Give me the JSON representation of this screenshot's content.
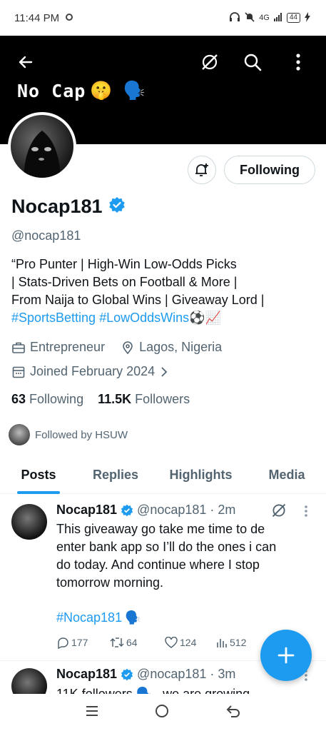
{
  "statusbar": {
    "time": "11:44 PM",
    "network": "4G",
    "battery": "44"
  },
  "header": {
    "title": "No Cap",
    "emoji1": "🤫",
    "emoji2": "🗣️"
  },
  "profile": {
    "follow_label": "Following",
    "name": "Nocap181",
    "handle": "@nocap181",
    "bio_lines": [
      "“Pro Punter | High-Win Low-Odds Picks",
      "| Stats-Driven Bets on Football & More |",
      "From Naija to Global Wins | Giveaway Lord |"
    ],
    "bio_tags": "#SportsBetting #LowOddsWins",
    "bio_emoji": "⚽📈",
    "category": "Entrepreneur",
    "location": "Lagos, Nigeria",
    "joined": "Joined February 2024",
    "following_count": "63",
    "following_label": "Following",
    "followers_count": "11.5K",
    "followers_label": "Followers",
    "followed_by": "Followed by HSUW"
  },
  "tabs": [
    "Posts",
    "Replies",
    "Highlights",
    "Media"
  ],
  "tweets": [
    {
      "name": "Nocap181",
      "handle": "@nocap181",
      "time": "· 2m",
      "lines": [
        "This giveaway go take me time to de",
        "enter bank app so I’ll do the ones i can",
        "do today. And continue where I stop",
        "tomorrow morning."
      ],
      "tag": "#Nocap181",
      "replies": "177",
      "retweets": "64",
      "likes": "124",
      "views": "512"
    },
    {
      "name": "Nocap181",
      "handle": "@nocap181",
      "time": "· 3m",
      "lines": [
        "11K followers 🗣️ , we are growing"
      ]
    }
  ],
  "colors": {
    "accent": "#1d9bf0",
    "text": "#0f1419",
    "muted": "#536471"
  }
}
